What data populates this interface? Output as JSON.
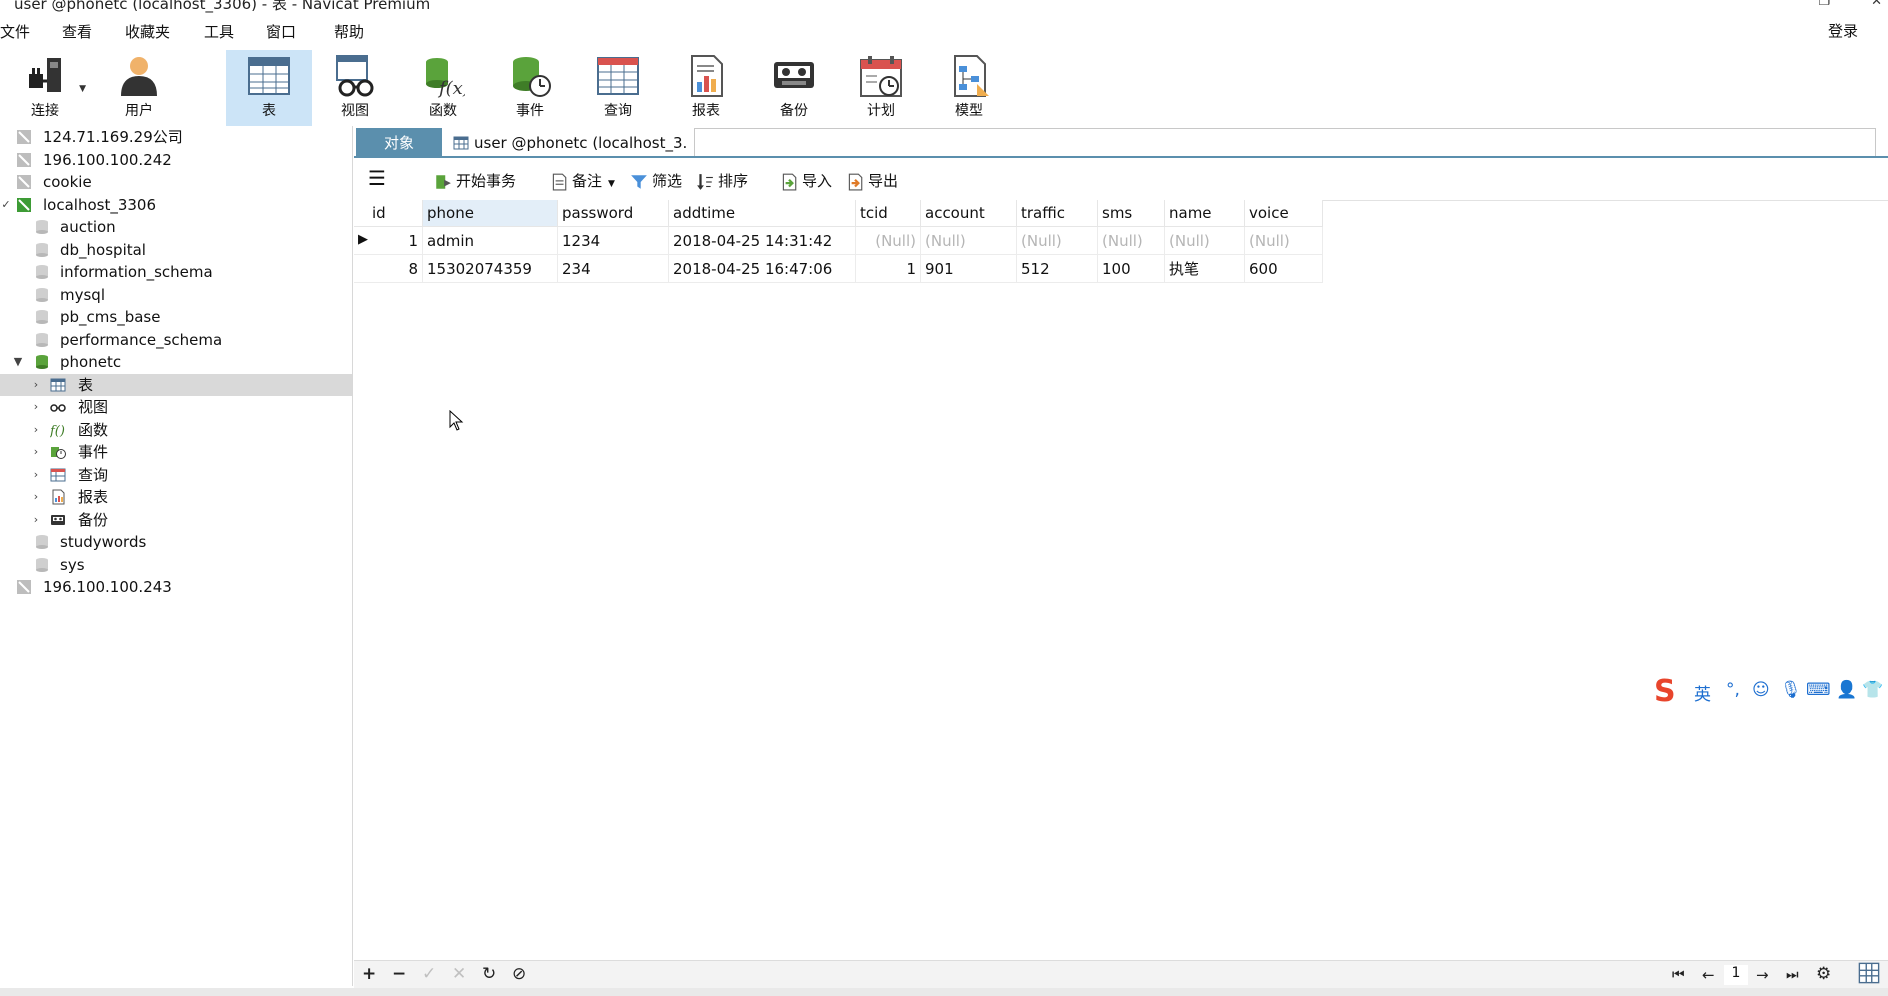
{
  "window": {
    "title": "user @phonetc (localhost_3306) - 表 - Navicat Premium"
  },
  "menu": [
    "文件",
    "查看",
    "收藏夹",
    "工具",
    "窗口",
    "帮助"
  ],
  "login_label": "登录",
  "toolbar": [
    {
      "label": "连接",
      "icon": "plug-icon"
    },
    {
      "label": "用户",
      "icon": "user-icon"
    },
    {
      "label": "表",
      "icon": "table-icon"
    },
    {
      "label": "视图",
      "icon": "view-icon"
    },
    {
      "label": "函数",
      "icon": "function-icon"
    },
    {
      "label": "事件",
      "icon": "event-icon"
    },
    {
      "label": "查询",
      "icon": "query-icon"
    },
    {
      "label": "报表",
      "icon": "report-icon"
    },
    {
      "label": "备份",
      "icon": "backup-icon"
    },
    {
      "label": "计划",
      "icon": "schedule-icon"
    },
    {
      "label": "模型",
      "icon": "model-icon"
    }
  ],
  "active_tool": "表",
  "sidebar": {
    "items": [
      {
        "label": "124.71.169.29公司"
      },
      {
        "label": "196.100.100.242"
      },
      {
        "label": "cookie"
      },
      {
        "label": "localhost_3306"
      },
      {
        "label": "auction"
      },
      {
        "label": "db_hospital"
      },
      {
        "label": "information_schema"
      },
      {
        "label": "mysql"
      },
      {
        "label": "pb_cms_base"
      },
      {
        "label": "performance_schema"
      },
      {
        "label": "phonetc"
      },
      {
        "label": "表"
      },
      {
        "label": "视图"
      },
      {
        "label": "函数"
      },
      {
        "label": "事件"
      },
      {
        "label": "查询"
      },
      {
        "label": "报表"
      },
      {
        "label": "备份"
      },
      {
        "label": "studywords"
      },
      {
        "label": "sys"
      },
      {
        "label": "196.100.100.243"
      }
    ]
  },
  "tabs": {
    "objects": "对象",
    "user_tab": "user @phonetc (localhost_3..."
  },
  "subtoolbar": {
    "begin_transaction": "开始事务",
    "note": "备注",
    "filter": "筛选",
    "sort": "排序",
    "import": "导入",
    "export": "导出"
  },
  "table": {
    "columns": [
      "id",
      "phone",
      "password",
      "addtime",
      "tcid",
      "account",
      "traffic",
      "sms",
      "name",
      "voice"
    ],
    "rows": [
      [
        "1",
        "admin",
        "1234",
        "2018-04-25 14:31:42",
        "(Null)",
        "(Null)",
        "(Null)",
        "(Null)",
        "(Null)",
        "(Null)"
      ],
      [
        "8",
        "15302074359",
        "234",
        "2018-04-25 16:47:06",
        "1",
        "901",
        "512",
        "100",
        "执笔",
        "600"
      ]
    ]
  },
  "pagination": {
    "page": "1"
  },
  "ime": {
    "lang": "英"
  }
}
